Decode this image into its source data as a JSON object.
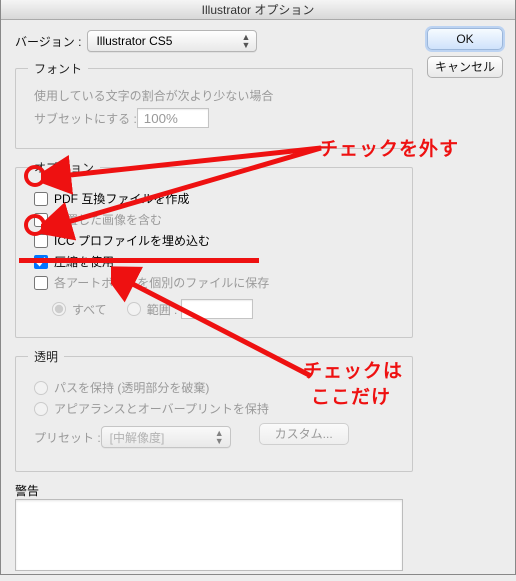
{
  "title": "Illustrator オプション",
  "buttons": {
    "ok": "OK",
    "cancel": "キャンセル"
  },
  "version": {
    "label": "バージョン :",
    "value": "Illustrator CS5"
  },
  "font": {
    "legend": "フォント",
    "desc": "使用している文字の割合が次より少ない場合",
    "subset_label": "サブセットにする :",
    "subset_value": "100%"
  },
  "options": {
    "legend": "オプション",
    "pdf": "PDF 互換ファイルを作成",
    "placed": "配置した画像を含む",
    "icc": "ICC プロファイルを埋め込む",
    "compress": "圧縮を使用",
    "eachartboard": "各アートボードを個別のファイルに保存",
    "radio_all": "すべて",
    "radio_range": "範囲 :"
  },
  "transparency": {
    "legend": "透明",
    "keep_path": "パスを保持 (透明部分を破棄)",
    "appearance": "アピアランスとオーバープリントを保持",
    "preset_label": "プリセット :",
    "preset_value": "[中解像度]",
    "custom": "カスタム..."
  },
  "warning_label": "警告",
  "annotations": {
    "uncheck": "チェックを外す",
    "onlyhere1": "チェックは",
    "onlyhere2": "ここだけ"
  }
}
